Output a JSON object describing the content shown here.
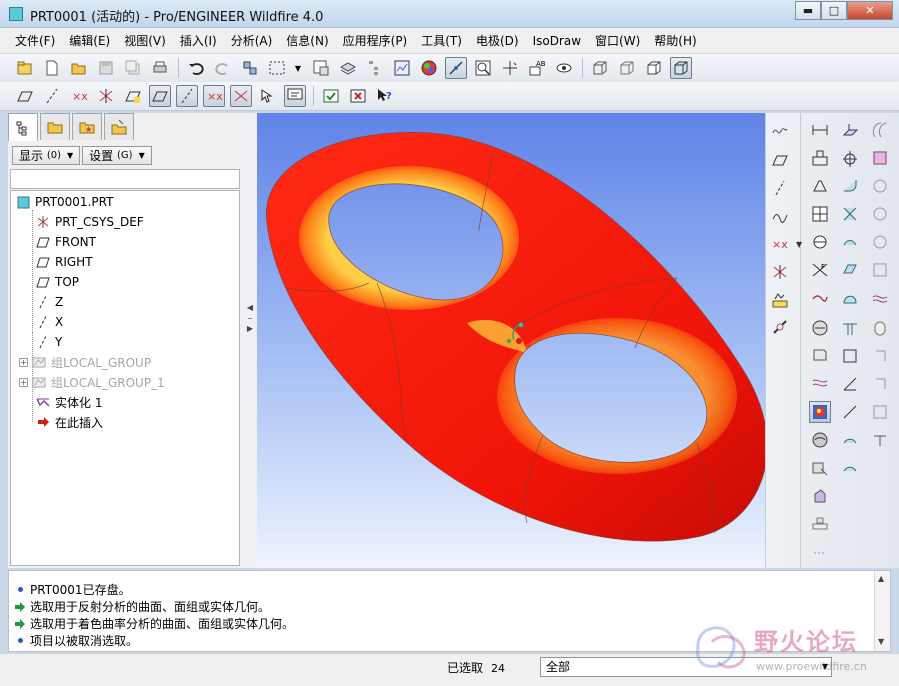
{
  "window": {
    "title": "PRT0001 (活动的) - Pro/ENGINEER Wildfire 4.0",
    "minimize": "▬",
    "maximize": "□",
    "close": "✕"
  },
  "menubar": {
    "items": [
      "文件(F)",
      "编辑(E)",
      "视图(V)",
      "插入(I)",
      "分析(A)",
      "信息(N)",
      "应用程序(P)",
      "工具(T)",
      "电极(D)",
      "IsoDraw",
      "窗口(W)",
      "帮助(H)"
    ]
  },
  "model_tree": {
    "show_label": "显示",
    "show_shortcut": "(0)",
    "settings_label": "设置",
    "settings_shortcut": "(G)",
    "items": [
      {
        "label": "PRT0001.PRT",
        "icon": "part-icon"
      },
      {
        "label": "PRT_CSYS_DEF",
        "icon": "csys-icon"
      },
      {
        "label": "FRONT",
        "icon": "datum-plane-icon"
      },
      {
        "label": "RIGHT",
        "icon": "datum-plane-icon"
      },
      {
        "label": "TOP",
        "icon": "datum-plane-icon"
      },
      {
        "label": "Z",
        "icon": "datum-axis-icon"
      },
      {
        "label": "X",
        "icon": "datum-axis-icon"
      },
      {
        "label": "Y",
        "icon": "datum-axis-icon"
      },
      {
        "label": "组LOCAL_GROUP",
        "icon": "group-icon"
      },
      {
        "label": "组LOCAL_GROUP_1",
        "icon": "group-icon"
      },
      {
        "label": "实体化 1",
        "icon": "solidify-icon"
      },
      {
        "label": "在此插入",
        "icon": "insert-here-arrow-icon"
      }
    ]
  },
  "messages": [
    {
      "text": "PRT0001已存盘。",
      "type": "info"
    },
    {
      "text": "选取用于反射分析的曲面、面组或实体几何。",
      "type": "prompt"
    },
    {
      "text": "选取用于着色曲率分析的曲面、面组或实体几何。",
      "type": "prompt"
    },
    {
      "text": "项目以被取消选取。",
      "type": "info"
    }
  ],
  "status": {
    "selected_label": "已选取",
    "selected_count": "24",
    "filter_value": "全部"
  },
  "watermark": {
    "text": "野火论坛",
    "url": "www.proewildfire.cn"
  },
  "colors": {
    "surface_red": "#ff1a10",
    "highlight_yellow": "#ffcc33",
    "background_top": "#5f83e8",
    "background_bottom": "#eef3fe"
  }
}
